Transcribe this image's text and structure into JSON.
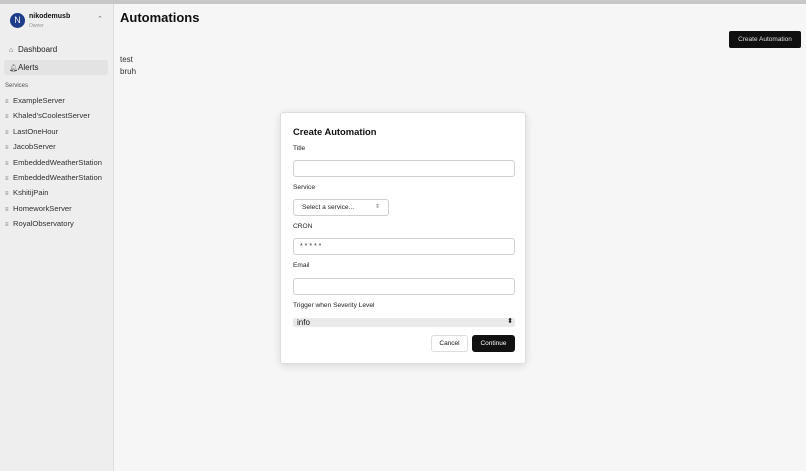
{
  "user": {
    "initial": "N",
    "name": "nikodemusb",
    "role": "Owner"
  },
  "nav": {
    "dashboard": "Dashboard",
    "alerts": "Alerts"
  },
  "services": {
    "heading": "Services",
    "items": [
      "ExampleServer",
      "Khaled'sCoolestServer",
      "LastOneHour",
      "JacobServer",
      "EmbeddedWeatherStation",
      "EmbeddedWeatherStation",
      "KshitijPain",
      "HomeworkServer",
      "RoyalObservatory"
    ]
  },
  "main": {
    "title": "Automations",
    "create_button": "Create Automation",
    "automations": [
      "test",
      "bruh"
    ]
  },
  "modal": {
    "title": "Create Automation",
    "title_label": "Title",
    "title_value": "",
    "service_label": "Service",
    "service_placeholder": "Select a service...",
    "cron_label": "CRON",
    "cron_value": "* * * * *",
    "email_label": "Email",
    "email_value": "",
    "severity_label": "Trigger when Severity Level",
    "severity_value": "info",
    "cancel": "Cancel",
    "continue": "Continue"
  },
  "colors": {
    "avatar": "#1f3f8f",
    "primary_button": "#111111"
  }
}
